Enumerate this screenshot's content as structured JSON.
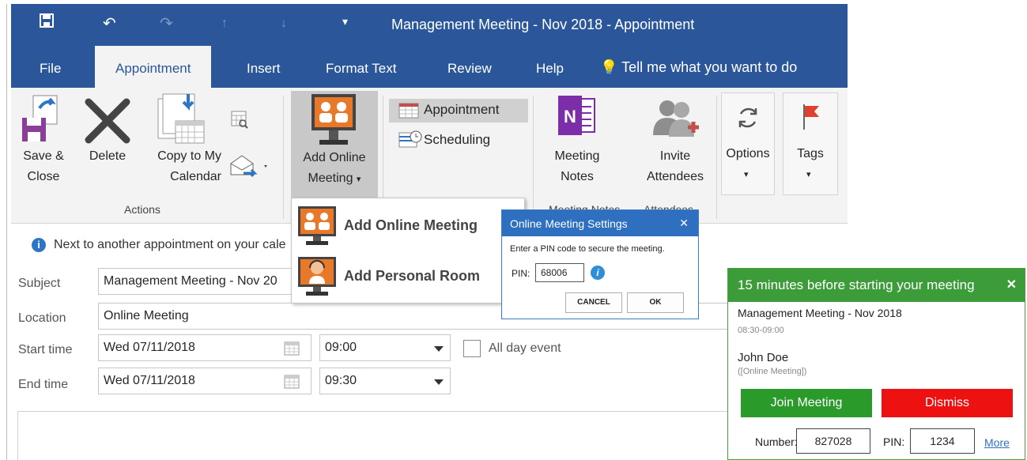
{
  "window": {
    "title": "Management Meeting - Nov 2018  -  Appointment"
  },
  "tabs": [
    "File",
    "Appointment",
    "Insert",
    "Format Text",
    "Review",
    "Help"
  ],
  "tell_me": "Tell me what you want to do",
  "ribbon": {
    "save_close": [
      "Save &",
      "Close"
    ],
    "delete": "Delete",
    "copy_to_calendar": [
      "Copy to My",
      "Calendar"
    ],
    "add_online_meeting": [
      "Add Online",
      "Meeting"
    ],
    "appointment": "Appointment",
    "scheduling": "Scheduling",
    "meeting_notes": [
      "Meeting",
      "Notes"
    ],
    "invite_attendees": [
      "Invite",
      "Attendees"
    ],
    "options": "Options",
    "tags": "Tags",
    "group_actions": "Actions",
    "group_meeting_notes": "Meeting Notes",
    "group_attendees": "Attendees"
  },
  "dropdown": {
    "items": [
      "Add Online Meeting",
      "Add Personal Room"
    ]
  },
  "info": "Next to another appointment on your cale",
  "form": {
    "subject_label": "Subject",
    "subject_value": "Management Meeting - Nov 20",
    "location_label": "Location",
    "location_value": "Online Meeting",
    "start_label": "Start time",
    "start_date": "Wed 07/11/2018",
    "start_time": "09:00",
    "all_day": "All day event",
    "end_label": "End time",
    "end_date": "Wed 07/11/2018",
    "end_time": "09:30"
  },
  "pin_dialog": {
    "title": "Online Meeting Settings",
    "prompt": "Enter a PIN code to secure the meeting.",
    "pin_label": "PIN:",
    "pin_value": "68006",
    "cancel": "CANCEL",
    "ok": "OK"
  },
  "reminder": {
    "header": "15 minutes before starting your meeting",
    "meeting_title": "Management Meeting - Nov 2018",
    "time": "08:30-09:00",
    "organizer": "John Doe",
    "location": "([Online Meeting])",
    "join": "Join Meeting",
    "dismiss": "Dismiss",
    "number_label": "Number:",
    "number_value": "827028",
    "pin_label": "PIN:",
    "pin_value": "1234",
    "more": "More"
  },
  "colors": {
    "title_blue": "#2b579a",
    "ribbon_bg": "#f3f3f3",
    "dialog_blue": "#2e6fc0",
    "reminder_green": "#3d9c3a",
    "join_green": "#2a9a2a",
    "dismiss_red": "#ee1111",
    "onenote_purple": "#7b2ea8"
  }
}
